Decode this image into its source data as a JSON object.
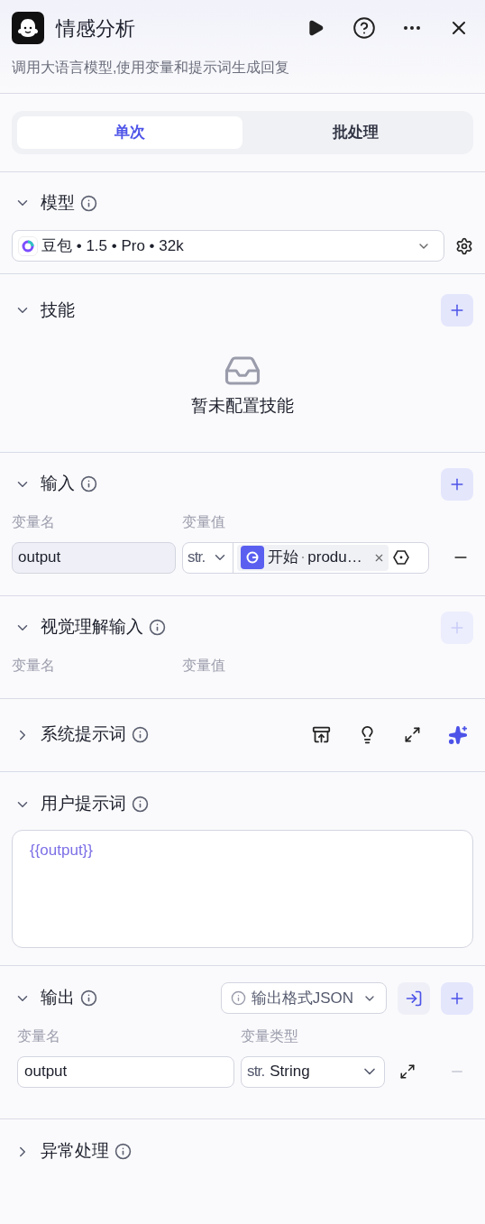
{
  "header": {
    "title": "情感分析",
    "description": "调用大语言模型,使用变量和提示词生成回复"
  },
  "mode_tabs": [
    {
      "label": "单次",
      "selected": true
    },
    {
      "label": "批处理",
      "selected": false
    }
  ],
  "sections": [
    {
      "kind": "model",
      "title": "模型",
      "expanded": true,
      "info": true,
      "model": "豆包 • 1.5 • Pro • 32k"
    },
    {
      "kind": "skills",
      "title": "技能",
      "expanded": true,
      "info": false,
      "add_disabled": false,
      "empty_text": "暂未配置技能"
    },
    {
      "kind": "variables",
      "title": "输入",
      "expanded": true,
      "info": true,
      "add_disabled": false,
      "columns": [
        "变量名",
        "变量值"
      ],
      "rows": [
        {
          "name": "output",
          "type": "str.",
          "source": "开始",
          "field": "produ…",
          "remove_disabled": false
        }
      ]
    },
    {
      "kind": "variables",
      "title": "视觉理解输入",
      "expanded": true,
      "info": true,
      "add_disabled": true,
      "columns": [
        "变量名",
        "变量值"
      ]
    },
    {
      "kind": "system_prompt",
      "title": "系统提示词",
      "expanded": false,
      "info": true
    },
    {
      "kind": "prompt",
      "title": "用户提示词",
      "expanded": true,
      "info": true,
      "value": "{{output}}"
    },
    {
      "kind": "output",
      "title": "输出",
      "expanded": true,
      "info": true,
      "format": "输出格式JSON",
      "add_disabled": false,
      "columns": [
        "变量名",
        "变量类型"
      ],
      "rows": [
        {
          "name": "output",
          "type_prefix": "str.",
          "type": "String",
          "remove_disabled": true
        }
      ]
    },
    {
      "kind": "plain",
      "title": "异常处理",
      "expanded": false,
      "info": true
    }
  ]
}
